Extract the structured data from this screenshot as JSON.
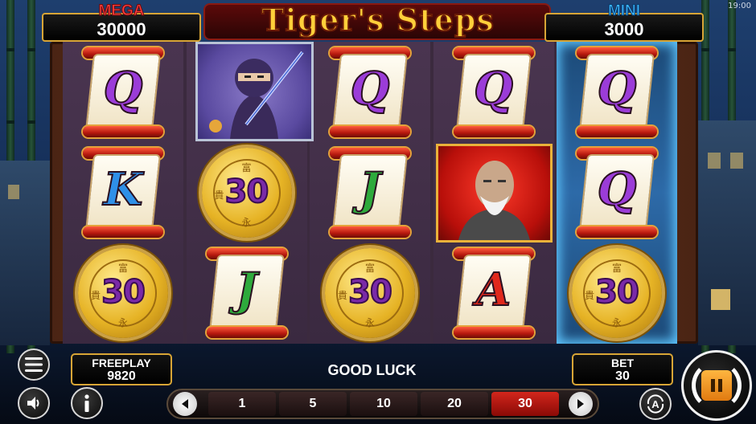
{
  "clock": "19:00",
  "game": {
    "title": "Tiger's Steps"
  },
  "jackpots": {
    "mega": {
      "label": "MEGA",
      "amount": "30000"
    },
    "mini": {
      "label": "MINI",
      "amount": "3000"
    }
  },
  "reels": [
    {
      "symbols": [
        {
          "kind": "scroll",
          "letter": "Q"
        },
        {
          "kind": "scroll",
          "letter": "K"
        },
        {
          "kind": "coin",
          "value": "30"
        }
      ]
    },
    {
      "symbols": [
        {
          "kind": "portrait",
          "name": "ninja"
        },
        {
          "kind": "coin",
          "value": "30"
        },
        {
          "kind": "scroll",
          "letter": "J"
        }
      ]
    },
    {
      "symbols": [
        {
          "kind": "scroll",
          "letter": "Q"
        },
        {
          "kind": "scroll",
          "letter": "J"
        },
        {
          "kind": "coin",
          "value": "30"
        }
      ]
    },
    {
      "symbols": [
        {
          "kind": "scroll",
          "letter": "Q"
        },
        {
          "kind": "portrait",
          "name": "sage"
        },
        {
          "kind": "scroll",
          "letter": "A"
        }
      ]
    },
    {
      "symbols": [
        {
          "kind": "scroll",
          "letter": "Q"
        },
        {
          "kind": "scroll",
          "letter": "Q"
        },
        {
          "kind": "coin",
          "value": "30"
        }
      ],
      "highlighted": true
    }
  ],
  "panel": {
    "freeplay_label": "FREEPLAY",
    "freeplay_value": "9820",
    "bet_label": "BET",
    "bet_value": "30",
    "status": "GOOD LUCK"
  },
  "lines": {
    "options": [
      "1",
      "5",
      "10",
      "20",
      "30"
    ],
    "selected": "30"
  },
  "buttons": {
    "auto_label": "A"
  },
  "colors": {
    "mega": "#ff3e3e",
    "mini": "#3cb7ff",
    "frame_gold": "#d8a536",
    "selected_line": "#d2261c"
  }
}
